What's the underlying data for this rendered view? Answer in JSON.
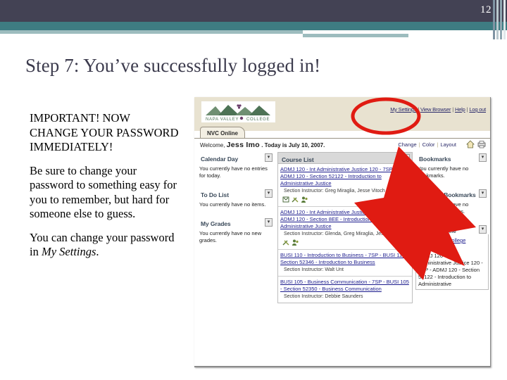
{
  "slide": {
    "page_number": "12",
    "title": "Step 7: You’ve successfully logged in!",
    "accent_navy": "#434254",
    "accent_teal": "#3e7c82",
    "accent_light_teal": "#9dbcbe",
    "annotation_red": "#e01b12"
  },
  "body": {
    "paragraph_1": "IMPORTANT!  NOW CHANGE YOUR PASSWORD IMMEDIATELY!",
    "paragraph_2": "Be sure to change your password to something easy for you to remember, but hard for someone else to guess.",
    "paragraph_3_before": "You can change your password in ",
    "paragraph_3_italic": "My Settings",
    "paragraph_3_after": "."
  },
  "portal": {
    "logo_text": "NAPA VALLEY COLLEGE",
    "top_links": [
      {
        "label": "My Settings"
      },
      {
        "label": "View Browser"
      },
      {
        "label": "Help"
      },
      {
        "label": "Log out"
      }
    ],
    "tab_label": "NVC Online",
    "welcome_prefix": "Welcome,",
    "welcome_user": "Jess Imo",
    "welcome_suffix": ". Today is July 10, 2007.",
    "welcome_links": [
      {
        "label": "Change"
      },
      {
        "label": "Color"
      },
      {
        "label": "Layout"
      }
    ],
    "icons": [
      {
        "name": "home-icon"
      },
      {
        "name": "print-icon"
      }
    ],
    "left_column": [
      {
        "title": "Calendar Day",
        "text": "You currently have no entries for today."
      },
      {
        "title": "To Do List",
        "text": "You currently have no items."
      },
      {
        "title": "My Grades",
        "text": "You currently have no new grades."
      }
    ],
    "course_list": {
      "title": "Course List",
      "courses": [
        {
          "link": "ADMJ 120 - Int Administrative Justice 120 - 7SP - ADMJ 120 - Section 52122 - Introduction to Administrative Justice",
          "meta": "Section Instructor: Greg Miraglia, Jesse Vitoch"
        },
        {
          "link": "ADMJ 120 - Int Administrative Justice 120 - SPR - ADMJ 120 - Section 8EE - Introduction to Administrative Justice",
          "meta": "Section Instructor: Glenda, Greg Miraglia, Jesse Trench"
        },
        {
          "link": "BUSI 110 - Introduction to Business - 7SP - BUSI 110 - Section 52346 - Introduction to Business",
          "meta": "Section Instructor: Walt Unt"
        },
        {
          "link": "BUSI 105 - Business Communication - 7SP - BUSI 105 - Section 52350 - Business Communication",
          "meta": "Section Instructor: Debbie Saunders"
        }
      ]
    },
    "right_column": [
      {
        "title": "Bookmarks",
        "text": "You currently have no bookmarks."
      },
      {
        "title": "Campus Bookmarks",
        "text": "You currently have no campus bookmarks."
      }
    ],
    "whos_online": {
      "title": "Who's Online",
      "group_link": "Napa Valley College",
      "count": "(4)",
      "course": "ADMJ 120 - Int Administrative Justice 120 - 7SP - ADMJ 120 - Section 52122 - Introduction to Administrative"
    }
  }
}
